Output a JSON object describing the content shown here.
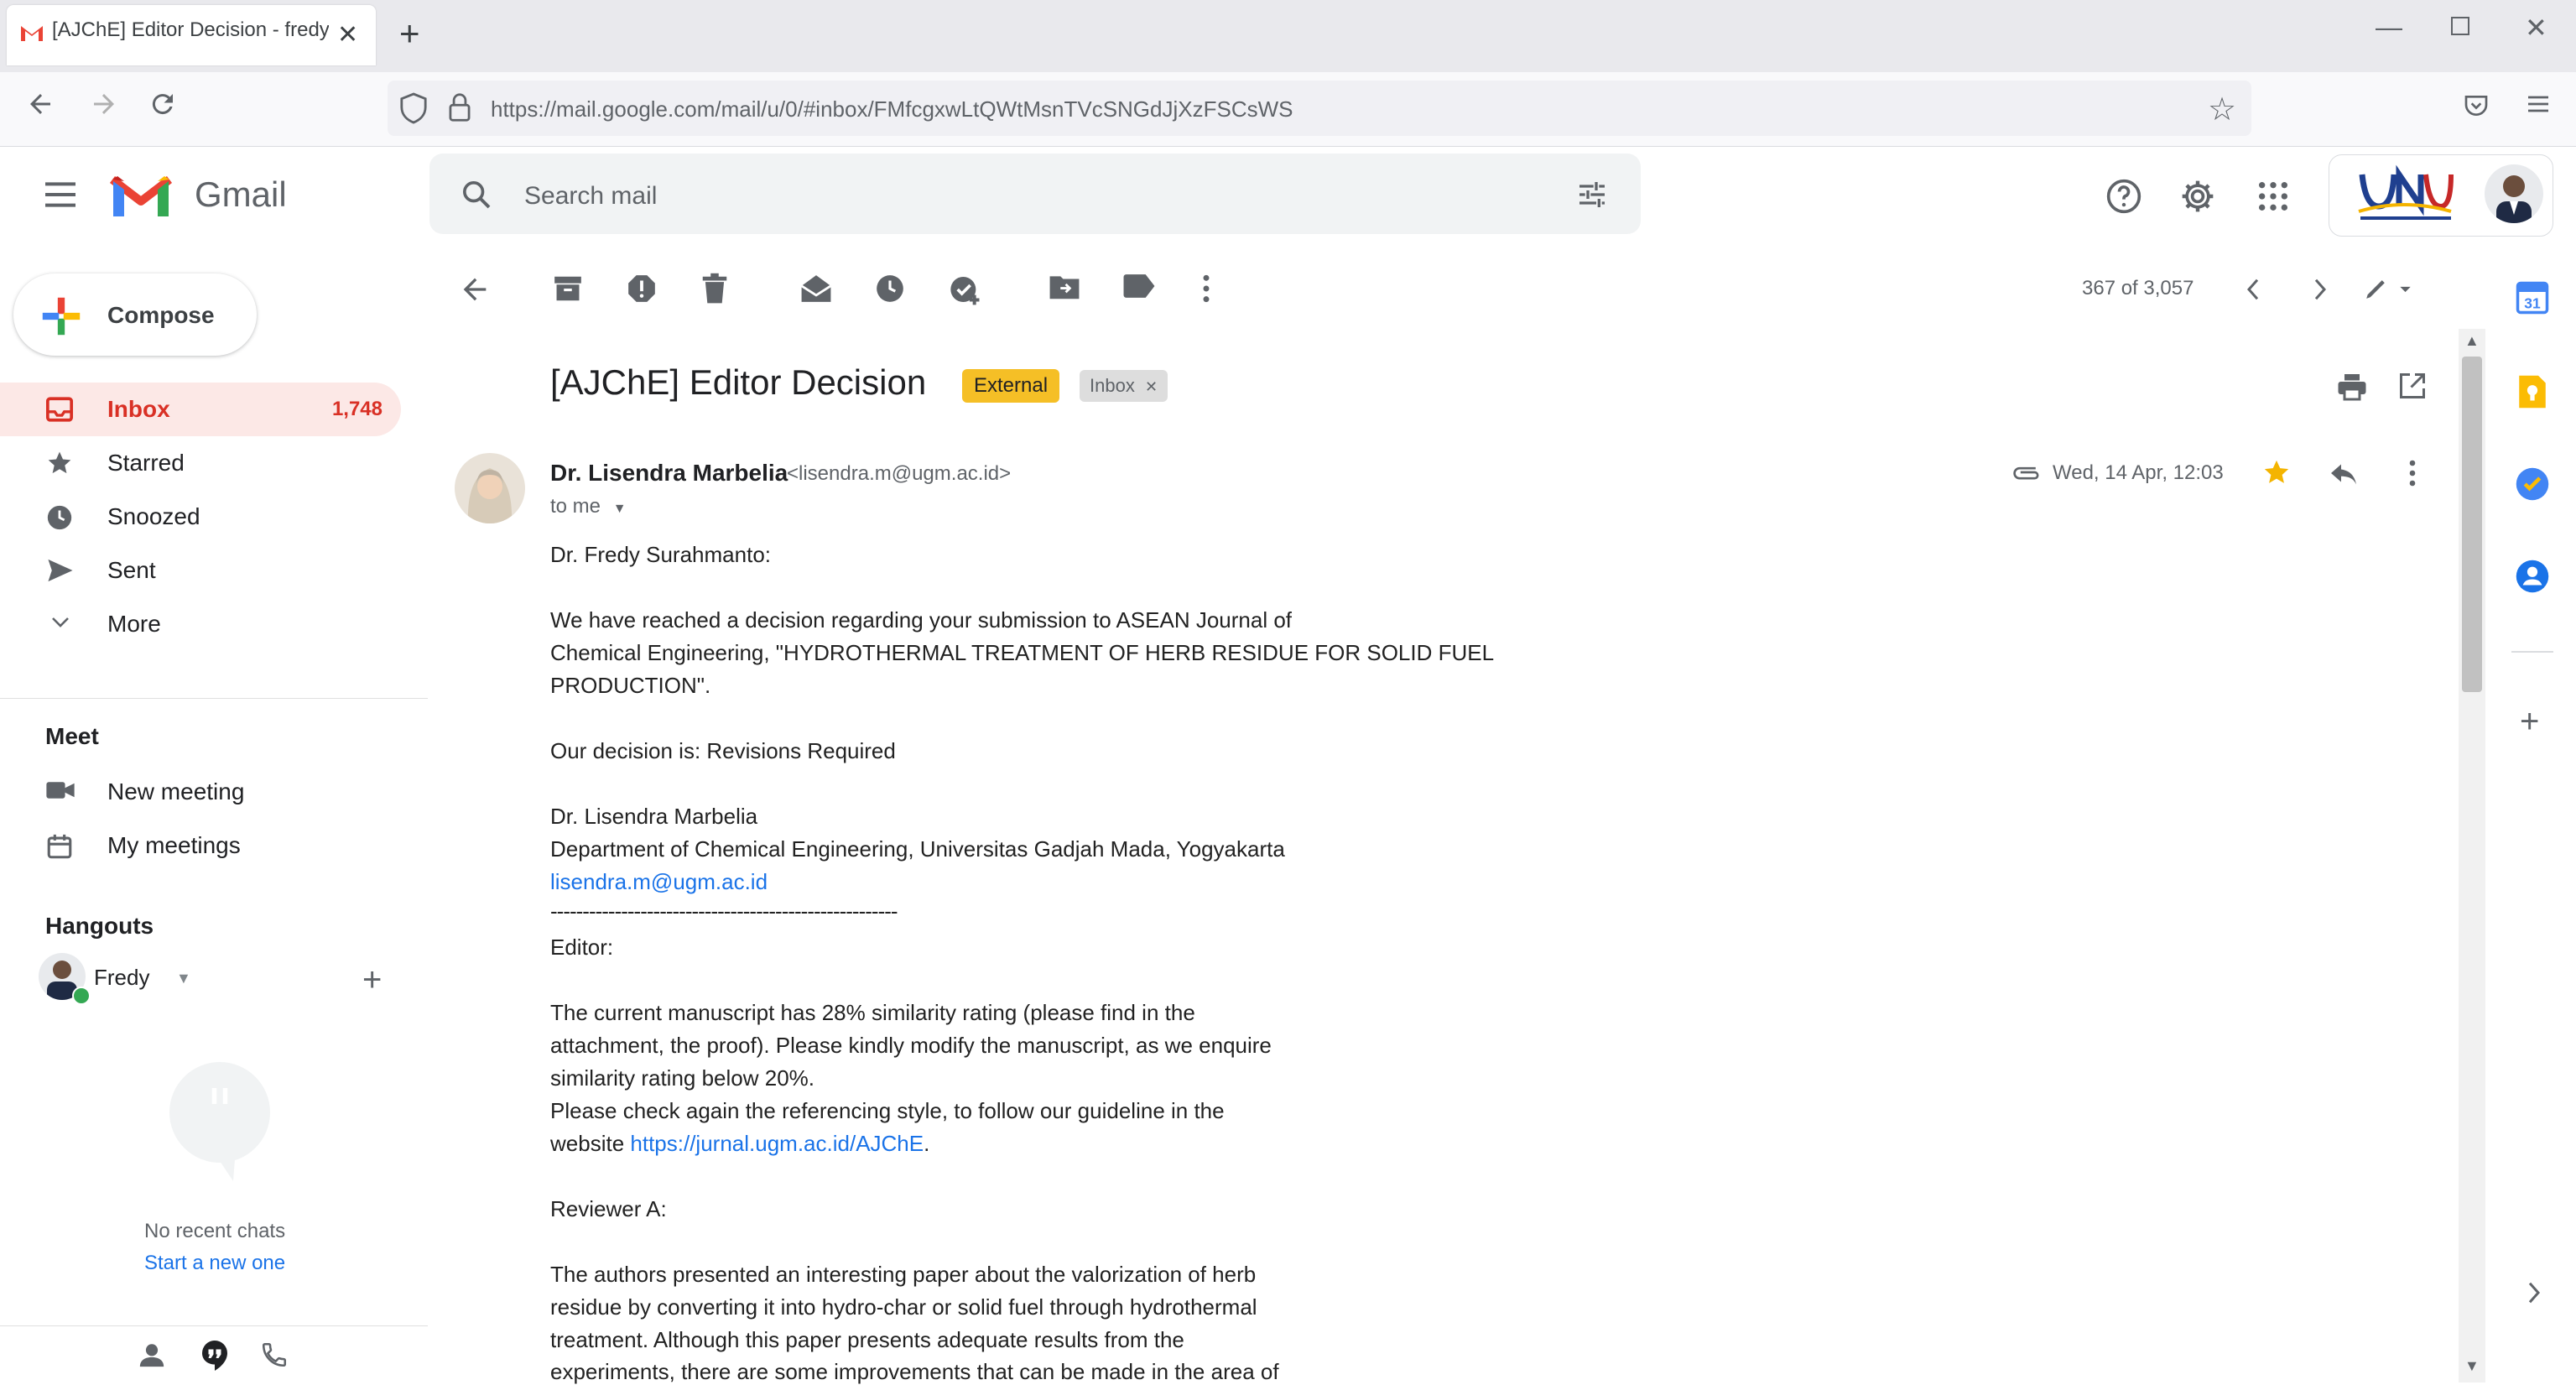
{
  "browser": {
    "tab_title": "[AJChE] Editor Decision - fredy",
    "url": "https://mail.google.com/mail/u/0/#inbox/FMfcgxwLtQWtMsnTVcSNGdJjXzFSCsWS"
  },
  "gmail": {
    "logo_text": "Gmail",
    "search_placeholder": "Search mail"
  },
  "sidebar": {
    "compose_label": "Compose",
    "items": [
      {
        "label": "Inbox",
        "count": "1,748"
      },
      {
        "label": "Starred"
      },
      {
        "label": "Snoozed"
      },
      {
        "label": "Sent"
      },
      {
        "label": "More"
      }
    ],
    "meet": {
      "title": "Meet",
      "new_meeting": "New meeting",
      "my_meetings": "My meetings"
    },
    "hangouts": {
      "title": "Hangouts",
      "user": "Fredy",
      "no_chats": "No recent chats",
      "start_new": "Start a new one"
    }
  },
  "toolbar": {
    "pager": "367 of 3,057"
  },
  "message": {
    "subject": "[AJChE] Editor Decision",
    "labels": {
      "external": "External",
      "inbox": "Inbox"
    },
    "sender_name": "Dr. Lisendra Marbelia",
    "sender_email": "<lisendra.m@ugm.ac.id>",
    "to": "to me",
    "date": "Wed, 14 Apr, 12:03",
    "body": [
      "Dr. Fredy Surahmanto:",
      "We have reached a decision regarding your submission to ASEAN Journal of",
      "Chemical Engineering, \"HYDROTHERMAL TREATMENT OF HERB RESIDUE FOR SOLID FUEL",
      "PRODUCTION\".",
      "Our decision is: Revisions Required",
      "Dr. Lisendra Marbelia",
      "Department of Chemical Engineering, Universitas Gadjah Mada, Yogyakarta",
      "lisendra.m@ugm.ac.id",
      "------------------------------------------------------",
      "Editor:",
      "The current manuscript has 28% similarity rating (please find in the",
      "attachment, the proof). Please kindly modify the manuscript, as we enquire",
      "similarity rating below 20%.",
      "Please check again the referencing style, to follow our guideline in the",
      "website ",
      "https://jurnal.ugm.ac.id/AJChE",
      ".",
      "Reviewer A:",
      "The authors presented an interesting paper about the valorization of herb",
      "residue by converting it into hydro-char or solid fuel through hydrothermal",
      "treatment. Although this paper presents adequate results from the",
      "experiments, there are some improvements that can be made in the area of"
    ]
  },
  "colors": {
    "accent_red": "#d93025",
    "link_blue": "#1a73e8",
    "external_label": "#f5bf26",
    "star": "#f4b400"
  },
  "icons": [
    "back-icon",
    "archive-icon",
    "spam-icon",
    "delete-icon",
    "mark-unread-icon",
    "snooze-icon",
    "add-task-icon",
    "move-to-icon",
    "label-icon",
    "more-vert-icon",
    "print-icon",
    "open-new-window-icon",
    "star-icon",
    "reply-icon"
  ]
}
